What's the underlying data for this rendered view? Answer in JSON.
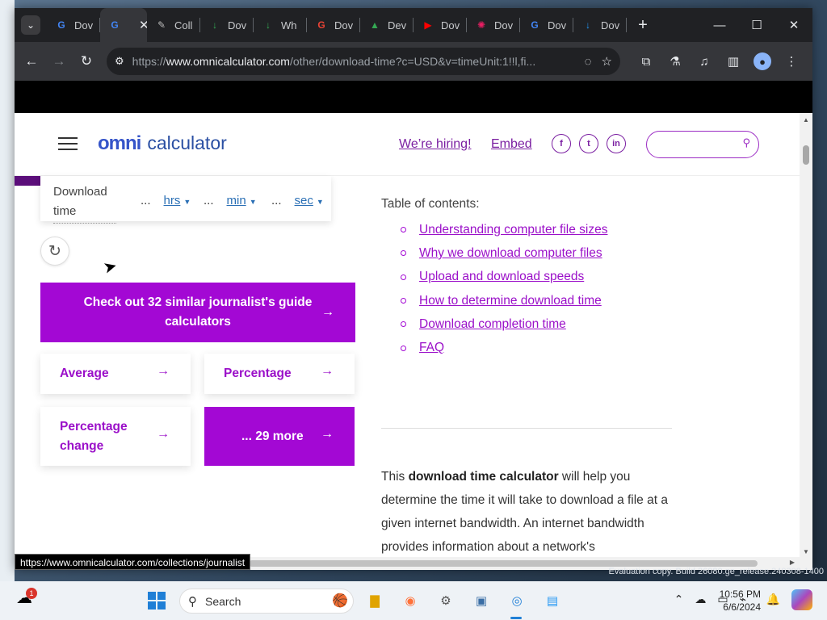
{
  "browser": {
    "tabs": [
      {
        "label": "Dov",
        "favicon": "G",
        "color": "#4285f4"
      },
      {
        "label": "",
        "favicon": "G",
        "color": "#4285f4",
        "active": true
      },
      {
        "label": "Coll",
        "favicon": "✎",
        "color": "#bbbbbb"
      },
      {
        "label": "Dov",
        "favicon": "↓",
        "color": "#34a853"
      },
      {
        "label": "Wh",
        "favicon": "↓",
        "color": "#34a853"
      },
      {
        "label": "Dov",
        "favicon": "G",
        "color": "#ea4335"
      },
      {
        "label": "Dev",
        "favicon": "▲",
        "color": "#34a853"
      },
      {
        "label": "Dov",
        "favicon": "▶",
        "color": "#ff0000"
      },
      {
        "label": "Dov",
        "favicon": "✺",
        "color": "#e91e63"
      },
      {
        "label": "Dov",
        "favicon": "G",
        "color": "#4285f4"
      },
      {
        "label": "Dov",
        "favicon": "↓",
        "color": "#2196f3"
      }
    ],
    "close_tab": "✕",
    "new_tab": "+",
    "window_controls": {
      "minimize": "—",
      "maximize": "☐",
      "close": "✕"
    },
    "url_prefix": "https://",
    "url_domain": "www.omnicalculator.com",
    "url_path": "/other/download-time?c=USD&v=timeUnit:1!!l,fi..."
  },
  "site": {
    "logo_left": "omni",
    "logo_right": "calculator",
    "hiring_link": "We’re hiring!",
    "embed_link": "Embed",
    "social": [
      "f",
      "t",
      "in"
    ],
    "search_placeholder": ""
  },
  "calculator": {
    "download_time_label": "Download time",
    "units": [
      {
        "value": "...",
        "unit": "hrs"
      },
      {
        "value": "...",
        "unit": "min"
      },
      {
        "value": "...",
        "unit": "sec"
      }
    ],
    "reset_icon": "↻"
  },
  "promo": {
    "headline": "Check out 32 similar journalist's guide calculators",
    "arrow": "→",
    "cards": [
      {
        "label": "Average"
      },
      {
        "label": "Percentage"
      },
      {
        "label": "Percentage change"
      },
      {
        "label": "... 29 more"
      }
    ]
  },
  "toc": {
    "title": "Table of contents:",
    "items": [
      "Understanding computer file sizes",
      "Why we download computer files",
      "Upload and download speeds",
      "How to determine download time",
      "Download completion time",
      "FAQ"
    ]
  },
  "intro": {
    "before": "This ",
    "bold": "download time calculator",
    "after": " will help you determine the time it will take to download a file at a given internet bandwidth. An internet bandwidth provides information about a network's"
  },
  "status_bar_url": "https://www.omnicalculator.com/collections/journalist",
  "taskbar": {
    "search_label": "Search",
    "notification_count": "1",
    "time": "10:56 PM",
    "date": "6/6/2024",
    "watermark": "Evaluation copy. Build 26080.ge_release.240308-1400"
  }
}
